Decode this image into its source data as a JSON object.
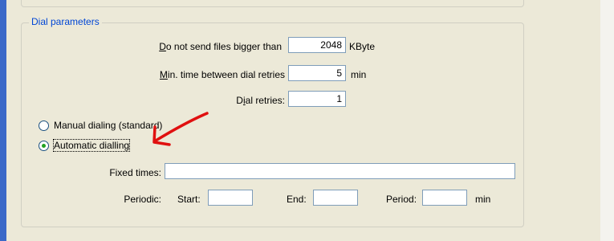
{
  "group": {
    "legend": "Dial parameters"
  },
  "limits": {
    "max_size": {
      "prefix": "",
      "mnemonic": "D",
      "rest": "o not send files bigger than",
      "value": "2048",
      "unit": "KByte"
    },
    "min_time": {
      "prefix": "",
      "mnemonic": "M",
      "rest": "in. time between dial retries",
      "value": "5",
      "unit": "min"
    },
    "retries": {
      "prefix": "D",
      "mnemonic": "i",
      "rest": "al retries:",
      "value": "1"
    }
  },
  "dialing": {
    "manual": {
      "label": "Manual dialing (standard)",
      "selected": false
    },
    "automatic": {
      "label": "Automatic dialling",
      "selected": true
    }
  },
  "schedule": {
    "fixed_label": "Fixed times:",
    "fixed_value": "",
    "periodic_label": "Periodic:",
    "start_label": "Start:",
    "start_value": "",
    "end_label": "End:",
    "end_value": "",
    "period_label": "Period:",
    "period_value": "",
    "period_unit": "min"
  },
  "annotation": {
    "arrow_color": "#e01010"
  }
}
